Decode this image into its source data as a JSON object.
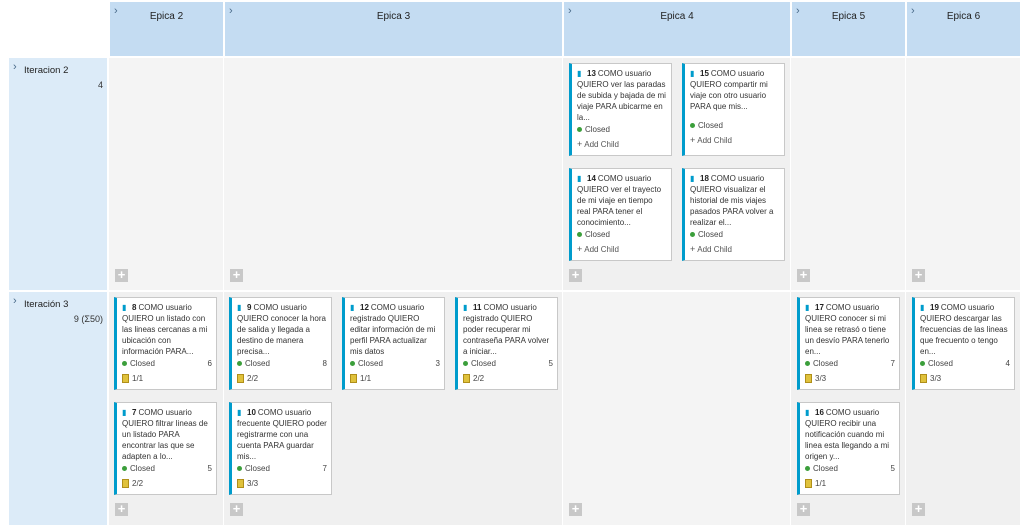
{
  "epics": [
    {
      "label": "Epica 2"
    },
    {
      "label": "Epica 3"
    },
    {
      "label": "Epica 4"
    },
    {
      "label": "Epica 5"
    },
    {
      "label": "Epica 6"
    }
  ],
  "iterations": [
    {
      "label": "Iteracion 2",
      "count": "4"
    },
    {
      "label": "Iteración 3",
      "count": "9 (Σ50)"
    }
  ],
  "add_symbol": "+",
  "add_child_label": "Add Child",
  "icons": {
    "chevron": "chevron-right-icon",
    "book": "book-icon",
    "clipboard": "clipboard-icon",
    "plus": "plus-icon"
  },
  "colors": {
    "header": "#c4dcf2",
    "iteration": "#dcebf8",
    "card_accent": "#009ccc",
    "closed": "#3b9f3b"
  },
  "cards": [
    {
      "id": "13",
      "text": "COMO usuario QUIERO ver las paradas de subida y bajada de mi viaje PARA ubicarme en la...",
      "status": "Closed",
      "effort": "",
      "tasks": ""
    },
    {
      "id": "15",
      "text": "COMO usuario QUIERO compartir mi viaje con otro usuario PARA que mis...",
      "status": "Closed",
      "effort": "",
      "tasks": ""
    },
    {
      "id": "14",
      "text": "COMO usuario QUIERO ver el trayecto de mi viaje en tiempo real PARA tener el conocimiento...",
      "status": "Closed",
      "effort": "",
      "tasks": ""
    },
    {
      "id": "18",
      "text": "COMO usuario QUIERO visualizar el historial de mis viajes pasados PARA volver a realizar el...",
      "status": "Closed",
      "effort": "",
      "tasks": ""
    },
    {
      "id": "8",
      "text": "COMO usuario QUIERO un listado con las lineas cercanas a mi ubicación con información PARA...",
      "status": "Closed",
      "effort": "6",
      "tasks": "1/1"
    },
    {
      "id": "9",
      "text": "COMO usuario QUIERO conocer la hora de salida y llegada a destino de manera precisa...",
      "status": "Closed",
      "effort": "8",
      "tasks": "2/2"
    },
    {
      "id": "12",
      "text": "COMO usuario registrado QUIERO editar información de mi perfil PARA actualizar mis datos",
      "status": "Closed",
      "effort": "3",
      "tasks": "1/1"
    },
    {
      "id": "11",
      "text": "COMO usuario registrado QUIERO poder recuperar mi contraseña PARA volver a iniciar...",
      "status": "Closed",
      "effort": "5",
      "tasks": "2/2"
    },
    {
      "id": "17",
      "text": "COMO usuario QUIERO conocer si mi linea se retrasó o tiene un desvío PARA tenerlo en...",
      "status": "Closed",
      "effort": "7",
      "tasks": "3/3"
    },
    {
      "id": "19",
      "text": "COMO usuario QUIERO descargar las frecuencias de las lineas que frecuento o tengo en...",
      "status": "Closed",
      "effort": "4",
      "tasks": "3/3"
    },
    {
      "id": "7",
      "text": "COMO usuario QUIERO filtrar lineas de un listado PARA encontrar las que se adapten a lo...",
      "status": "Closed",
      "effort": "5",
      "tasks": "2/2"
    },
    {
      "id": "10",
      "text": "COMO usuario frecuente QUIERO poder registrarme con una cuenta PARA guardar mis...",
      "status": "Closed",
      "effort": "7",
      "tasks": "3/3"
    },
    {
      "id": "16",
      "text": "COMO usuario QUIERO recibir una notificación cuando mi linea esta llegando a mi origen y...",
      "status": "Closed",
      "effort": "5",
      "tasks": "1/1"
    }
  ]
}
